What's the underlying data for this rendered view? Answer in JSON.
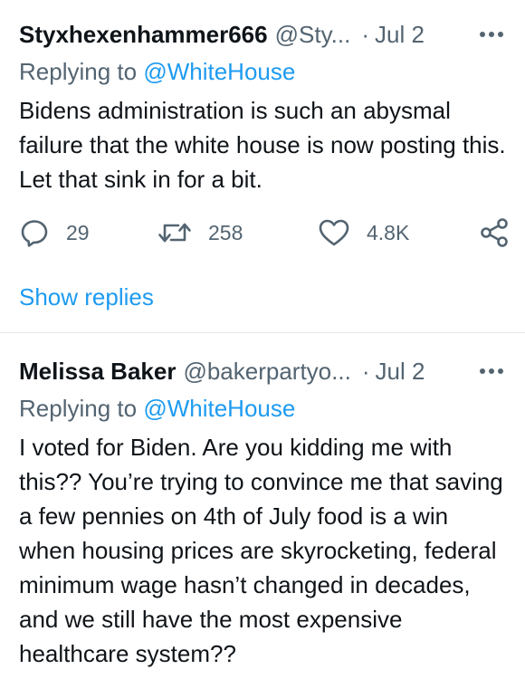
{
  "tweets": [
    {
      "name": "Styxhexenhammer666",
      "handle": "@Sty...",
      "separator": "·",
      "date": "Jul 2",
      "replying_prefix": "Replying to",
      "replying_to": "@WhiteHouse",
      "text": "Bidens administration is such an abysmal failure that the white house is now posting this. Let that sink in for a bit.",
      "reply_count": "29",
      "retweet_count": "258",
      "like_count": "4.8K",
      "show_replies_label": "Show replies"
    },
    {
      "name": "Melissa Baker",
      "handle": "@bakerpartyo...",
      "separator": "·",
      "date": "Jul 2",
      "replying_prefix": "Replying to",
      "replying_to": "@WhiteHouse",
      "text": "I voted for Biden. Are you kidding me with this?? You’re trying to convince me that saving a few pennies on 4th of July food is a win when housing prices are skyrocketing, federal minimum wage hasn’t changed in decades, and we still have the most expensive healthcare system??"
    }
  ],
  "icons": {
    "more": "more-icon",
    "reply": "reply-icon",
    "retweet": "retweet-icon",
    "like": "heart-icon",
    "share": "share-icon"
  },
  "colors": {
    "link": "#1d9bf0",
    "secondary_text": "#536471",
    "primary_text": "#0f1419",
    "divider": "#e3e6e9"
  }
}
